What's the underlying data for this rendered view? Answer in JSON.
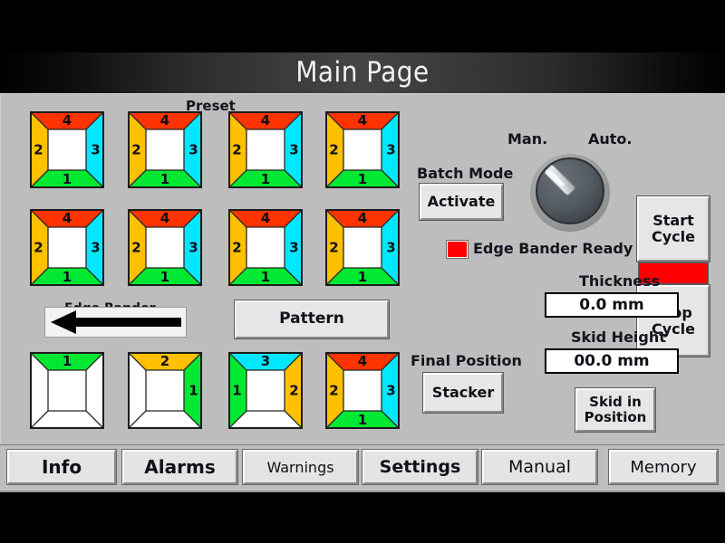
{
  "window": {
    "title": "Main Page"
  },
  "colors": {
    "panel_bg": "#bdbdbd",
    "edge_red": "#ff3300",
    "edge_orange": "#ffc000",
    "edge_green": "#00e832",
    "edge_cyan": "#00e8ff",
    "lamp_red": "#ff0000",
    "accent_bar": "#ff0000"
  },
  "preset": {
    "heading": "Preset",
    "tiles": [
      {
        "name": "preset-tile-1",
        "edges": {
          "top": "4",
          "left": "2",
          "right": "3",
          "bottom": "1"
        }
      },
      {
        "name": "preset-tile-2",
        "edges": {
          "top": "4",
          "left": "2",
          "right": "3",
          "bottom": "1"
        }
      },
      {
        "name": "preset-tile-3",
        "edges": {
          "top": "4",
          "left": "2",
          "right": "3",
          "bottom": "1"
        }
      },
      {
        "name": "preset-tile-4",
        "edges": {
          "top": "4",
          "left": "2",
          "right": "3",
          "bottom": "1"
        }
      },
      {
        "name": "preset-tile-5",
        "edges": {
          "top": "4",
          "left": "2",
          "right": "3",
          "bottom": "1"
        }
      },
      {
        "name": "preset-tile-6",
        "edges": {
          "top": "4",
          "left": "2",
          "right": "3",
          "bottom": "1"
        }
      },
      {
        "name": "preset-tile-7",
        "edges": {
          "top": "4",
          "left": "2",
          "right": "3",
          "bottom": "1"
        }
      },
      {
        "name": "preset-tile-8",
        "edges": {
          "top": "4",
          "left": "2",
          "right": "3",
          "bottom": "1"
        }
      }
    ]
  },
  "sequence": {
    "tiles": [
      {
        "name": "sequence-tile-1",
        "top": "1",
        "left": "",
        "right": "",
        "bottom": ""
      },
      {
        "name": "sequence-tile-2",
        "top": "2",
        "left": "",
        "right": "1",
        "bottom": ""
      },
      {
        "name": "sequence-tile-3",
        "top": "3",
        "left": "1",
        "right": "2",
        "bottom": ""
      },
      {
        "name": "sequence-tile-4",
        "top": "4",
        "left": "2",
        "right": "3",
        "bottom": "1"
      }
    ]
  },
  "edge_bander": {
    "label": "Edge Bander",
    "direction": "left"
  },
  "pattern": {
    "label": "Pattern"
  },
  "batch_mode": {
    "label": "Batch Mode",
    "button": "Activate"
  },
  "status": {
    "edge_bander_ready": "Edge Bander Ready"
  },
  "selector": {
    "left_label": "Man.",
    "right_label": "Auto.",
    "position": "Man."
  },
  "cycle": {
    "start": "Start\nCycle",
    "start_line1": "Start",
    "start_line2": "Cycle",
    "stop_line1": "Stop",
    "stop_line2": "Cycle"
  },
  "final_position": {
    "label": "Final Position",
    "button": "Stacker"
  },
  "measurements": {
    "thickness_label": "Thickness",
    "thickness_value": "0.0 mm",
    "skid_height_label": "Skid Height",
    "skid_height_value": "00.0 mm",
    "skid_button_line1": "Skid in",
    "skid_button_line2": "Position"
  },
  "tabs": [
    {
      "label": "Info",
      "name": "tab-info"
    },
    {
      "label": "Alarms",
      "name": "tab-alarms"
    },
    {
      "label": "Warnings",
      "name": "tab-warnings"
    },
    {
      "label": "Settings",
      "name": "tab-settings"
    },
    {
      "label": "Manual",
      "name": "tab-manual"
    },
    {
      "label": "Memory",
      "name": "tab-memory"
    }
  ]
}
